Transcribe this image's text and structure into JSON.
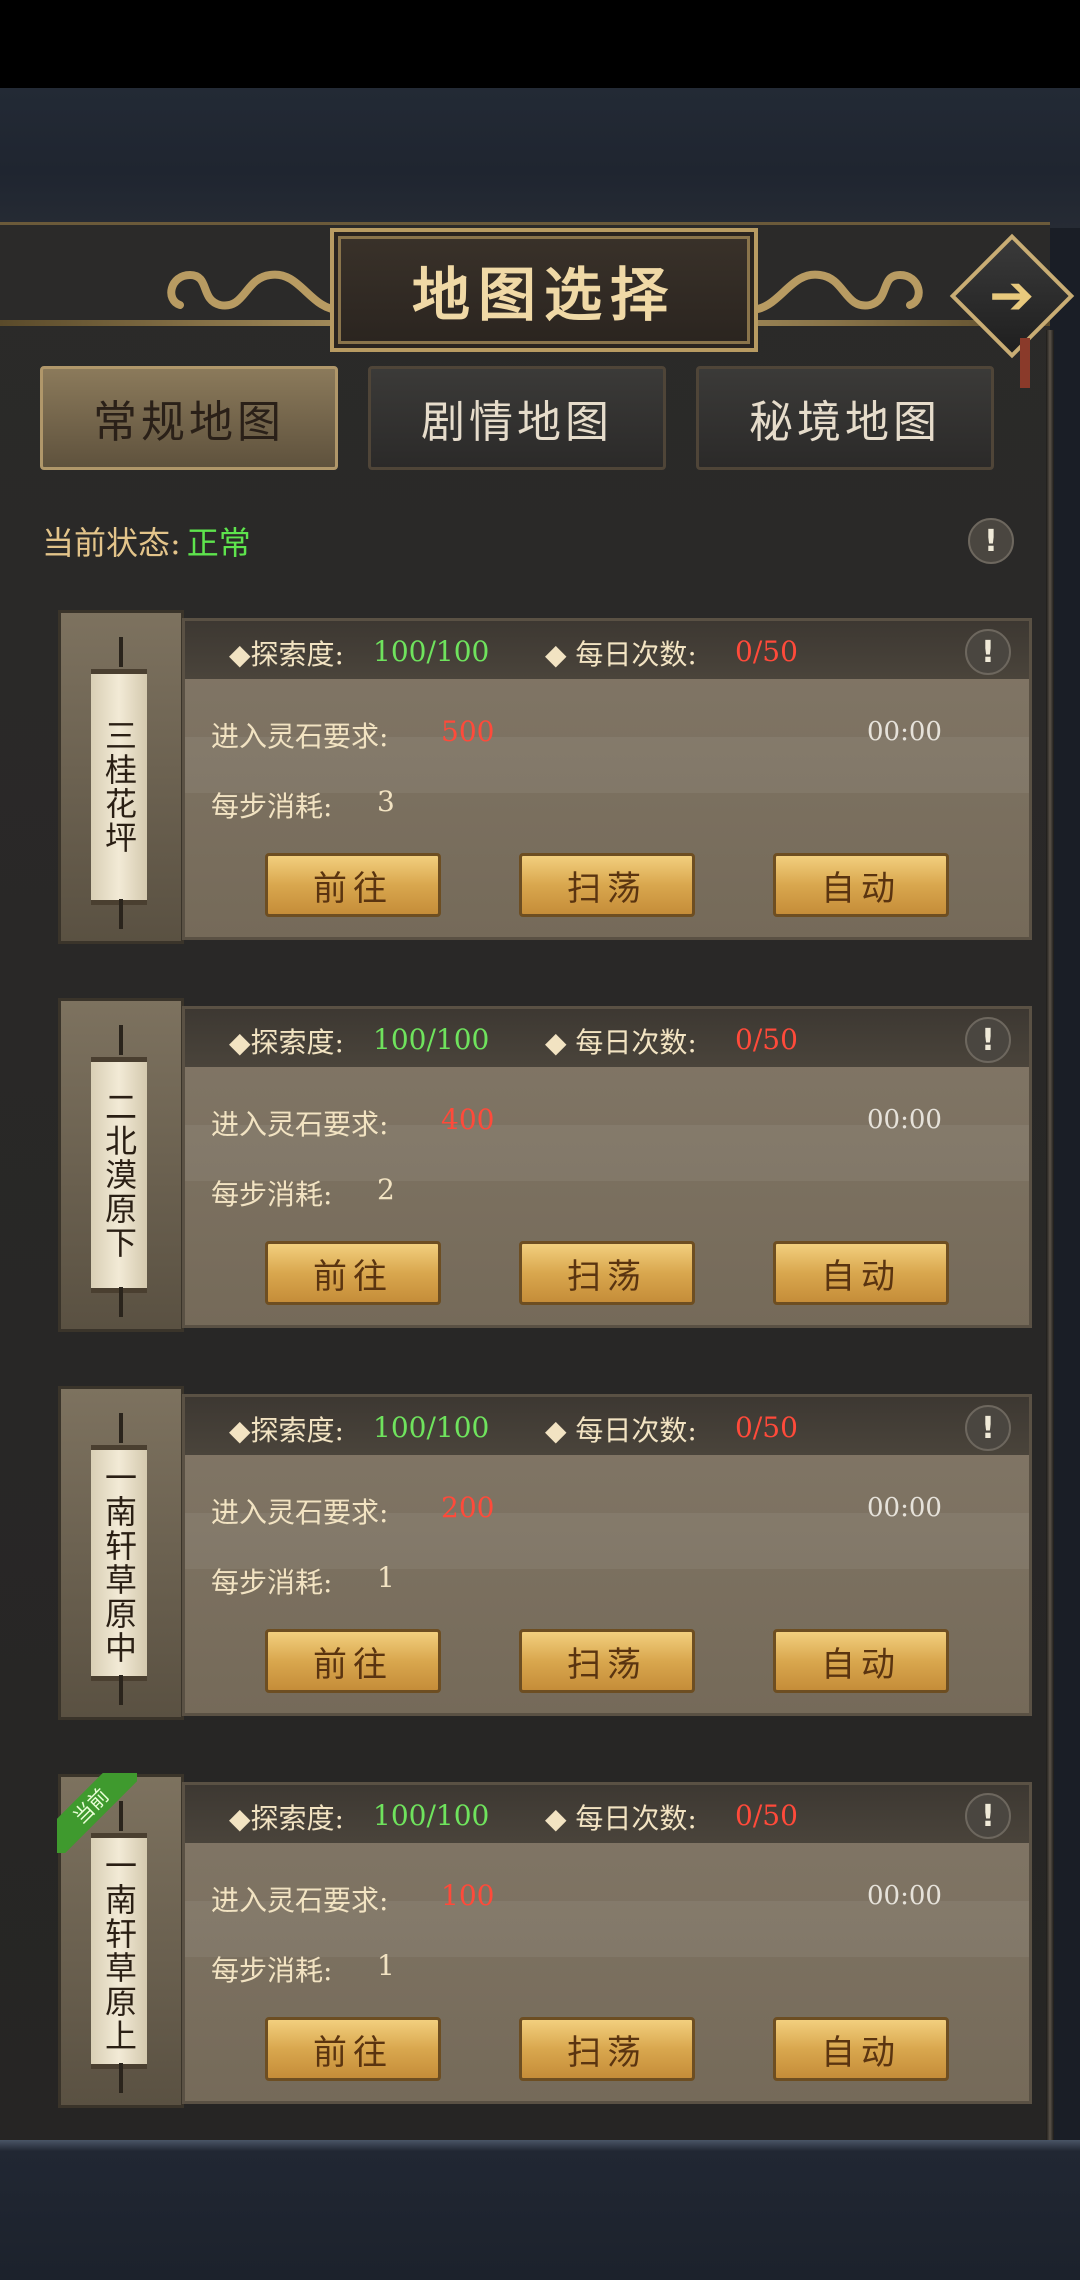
{
  "header": {
    "title": "地图选择"
  },
  "tabs": [
    {
      "label": "常规地图",
      "active": true
    },
    {
      "label": "剧情地图",
      "active": false
    },
    {
      "label": "秘境地图",
      "active": false
    }
  ],
  "status": {
    "label": "当前状态:",
    "value": "正常"
  },
  "cards": [
    {
      "name": "三桂花坪",
      "explore_label": "◆探索度:",
      "explore_value": "100/100",
      "daily_label": "◆ 每日次数:",
      "daily_value": "0/50",
      "stone_label": "进入灵石要求:",
      "stone_value": "500",
      "timer": "00:00",
      "step_label": "每步消耗:",
      "step_value": "3",
      "current": false
    },
    {
      "name": "二北漠原下",
      "explore_label": "◆探索度:",
      "explore_value": "100/100",
      "daily_label": "◆ 每日次数:",
      "daily_value": "0/50",
      "stone_label": "进入灵石要求:",
      "stone_value": "400",
      "timer": "00:00",
      "step_label": "每步消耗:",
      "step_value": "2",
      "current": false
    },
    {
      "name": "一南轩草原中",
      "explore_label": "◆探索度:",
      "explore_value": "100/100",
      "daily_label": "◆ 每日次数:",
      "daily_value": "0/50",
      "stone_label": "进入灵石要求:",
      "stone_value": "200",
      "timer": "00:00",
      "step_label": "每步消耗:",
      "step_value": "1",
      "current": false
    },
    {
      "name": "一南轩草原上",
      "explore_label": "◆探索度:",
      "explore_value": "100/100",
      "daily_label": "◆ 每日次数:",
      "daily_value": "0/50",
      "stone_label": "进入灵石要求:",
      "stone_value": "100",
      "timer": "00:00",
      "step_label": "每步消耗:",
      "step_value": "1",
      "current": true,
      "current_tag": "当前"
    }
  ],
  "buttons": {
    "go": "前往",
    "sweep": "扫荡",
    "auto": "自动"
  },
  "icons": {
    "info": "!",
    "next": "➔"
  }
}
